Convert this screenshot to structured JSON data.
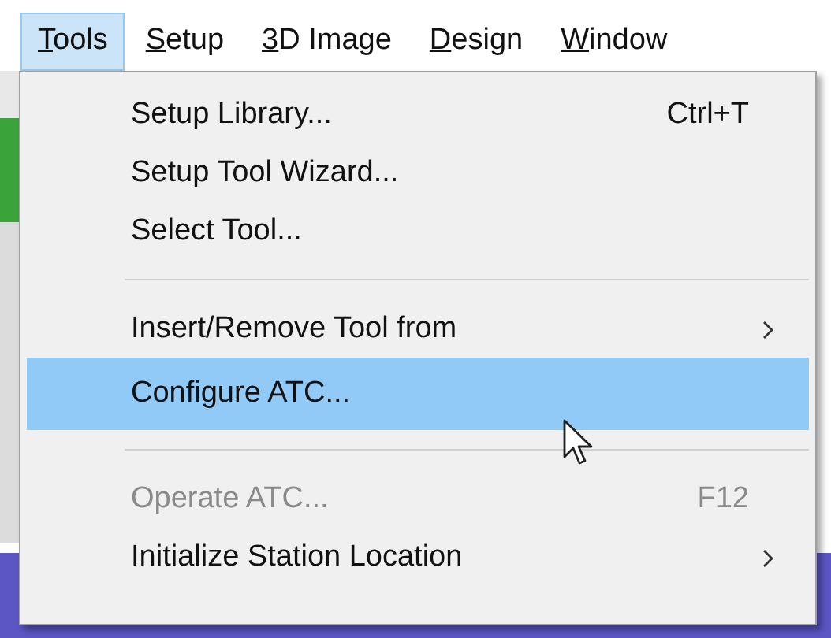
{
  "menu_bar": [
    {
      "label": "Tools",
      "selected": true
    },
    {
      "label": "Setup",
      "selected": false
    },
    {
      "label": "3D Image",
      "selected": false
    },
    {
      "label": "Design",
      "selected": false
    },
    {
      "label": "Window",
      "selected": false
    }
  ],
  "dropdown": {
    "items": [
      {
        "kind": "command",
        "label": "Setup Library...",
        "shortcut": "Ctrl+T",
        "submenu": false,
        "disabled": false,
        "selected": false
      },
      {
        "kind": "command",
        "label": "Setup Tool Wizard...",
        "submenu": false,
        "disabled": false,
        "selected": false
      },
      {
        "kind": "command",
        "label": "Select Tool...",
        "submenu": false,
        "disabled": false,
        "selected": false
      },
      {
        "kind": "separator"
      },
      {
        "kind": "command",
        "label": "Insert/Remove Tool from",
        "submenu": true,
        "disabled": false,
        "selected": false
      },
      {
        "kind": "command",
        "label": "Configure ATC...",
        "submenu": false,
        "disabled": false,
        "selected": true
      },
      {
        "kind": "separator"
      },
      {
        "kind": "command",
        "label": "Operate ATC...",
        "shortcut": "F12",
        "submenu": false,
        "disabled": true,
        "selected": false
      },
      {
        "kind": "command",
        "label": "Initialize Station Location",
        "submenu": true,
        "disabled": false,
        "selected": false
      }
    ]
  }
}
